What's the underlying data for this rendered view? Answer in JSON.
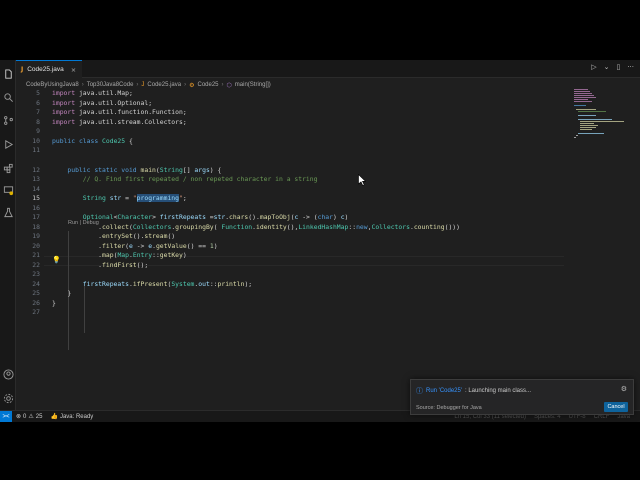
{
  "tab": {
    "icon": "J",
    "title": "Code25.java",
    "close": "×"
  },
  "breadcrumb": [
    "CodeByUsingJava8",
    "Top30Java8Code",
    "Code25.java",
    "Code25",
    "main(String[])"
  ],
  "editor": {
    "codelens_run": "Run",
    "codelens_sep": "|",
    "codelens_debug": "Debug",
    "lines": [
      {
        "n": "5",
        "tokens": [
          [
            "kw2",
            "import "
          ],
          [
            "op",
            "java.util.Map;"
          ]
        ]
      },
      {
        "n": "6",
        "tokens": [
          [
            "kw2",
            "import "
          ],
          [
            "op",
            "java.util.Optional;"
          ]
        ]
      },
      {
        "n": "7",
        "tokens": [
          [
            "kw2",
            "import "
          ],
          [
            "op",
            "java.util.function.Function;"
          ]
        ]
      },
      {
        "n": "8",
        "tokens": [
          [
            "kw2",
            "import "
          ],
          [
            "op",
            "java.util.stream.Collectors;"
          ]
        ]
      },
      {
        "n": "9",
        "tokens": []
      },
      {
        "n": "10",
        "tokens": [
          [
            "kw",
            "public "
          ],
          [
            "kw",
            "class "
          ],
          [
            "ty",
            "Code25"
          ],
          [
            "op",
            " {"
          ]
        ]
      },
      {
        "n": "11",
        "tokens": []
      },
      {
        "n": "12",
        "tokens": [
          [
            "op",
            "    "
          ],
          [
            "kw",
            "public "
          ],
          [
            "kw",
            "static "
          ],
          [
            "kw",
            "void "
          ],
          [
            "fn",
            "main"
          ],
          [
            "op",
            "("
          ],
          [
            "ty",
            "String"
          ],
          [
            "op",
            "[] "
          ],
          [
            "vr",
            "args"
          ],
          [
            "op",
            ") {"
          ]
        ]
      },
      {
        "n": "13",
        "tokens": [
          [
            "cm",
            "        // Q. Find first repeated / non repeted character in a string"
          ]
        ]
      },
      {
        "n": "14",
        "tokens": []
      },
      {
        "n": "15",
        "tokens": [
          [
            "op",
            "        "
          ],
          [
            "ty",
            "String "
          ],
          [
            "vr",
            "str"
          ],
          [
            "op",
            " = "
          ],
          [
            "st",
            "\""
          ],
          [
            "sel",
            "programming"
          ],
          [
            "st",
            "\""
          ],
          [
            "op",
            ";"
          ]
        ]
      },
      {
        "n": "16",
        "tokens": []
      },
      {
        "n": "17",
        "tokens": [
          [
            "op",
            "        "
          ],
          [
            "ty",
            "Optional"
          ],
          [
            "op",
            "<"
          ],
          [
            "ty",
            "Character"
          ],
          [
            "op",
            "> "
          ],
          [
            "vr",
            "firstRepeats"
          ],
          [
            "op",
            " ="
          ],
          [
            "vr",
            "str"
          ],
          [
            "op",
            "."
          ],
          [
            "fn",
            "chars"
          ],
          [
            "op",
            "()."
          ],
          [
            "fn",
            "mapToObj"
          ],
          [
            "op",
            "("
          ],
          [
            "vr",
            "c"
          ],
          [
            "op",
            " -> ("
          ],
          [
            "kw",
            "char"
          ],
          [
            "op",
            ") "
          ],
          [
            "vr",
            "c"
          ],
          [
            "op",
            ")"
          ]
        ]
      },
      {
        "n": "18",
        "tokens": [
          [
            "op",
            "            ."
          ],
          [
            "fn",
            "collect"
          ],
          [
            "op",
            "("
          ],
          [
            "ty",
            "Collectors"
          ],
          [
            "op",
            "."
          ],
          [
            "fn",
            "groupingBy"
          ],
          [
            "op",
            "( "
          ],
          [
            "ty",
            "Function"
          ],
          [
            "op",
            "."
          ],
          [
            "fn",
            "identity"
          ],
          [
            "op",
            "(),"
          ],
          [
            "ty",
            "LinkedHashMap"
          ],
          [
            "op",
            "::"
          ],
          [
            "kw",
            "new"
          ],
          [
            "op",
            ","
          ],
          [
            "ty",
            "Collectors"
          ],
          [
            "op",
            "."
          ],
          [
            "fn",
            "counting"
          ],
          [
            "op",
            "()))"
          ]
        ]
      },
      {
        "n": "19",
        "tokens": [
          [
            "op",
            "            ."
          ],
          [
            "fn",
            "entrySet"
          ],
          [
            "op",
            "()."
          ],
          [
            "fn",
            "stream"
          ],
          [
            "op",
            "()"
          ]
        ]
      },
      {
        "n": "20",
        "tokens": [
          [
            "op",
            "            ."
          ],
          [
            "fn",
            "filter"
          ],
          [
            "op",
            "("
          ],
          [
            "vr",
            "e"
          ],
          [
            "op",
            " -> "
          ],
          [
            "vr",
            "e"
          ],
          [
            "op",
            "."
          ],
          [
            "fn",
            "getValue"
          ],
          [
            "op",
            "() == "
          ],
          [
            "nm",
            "1"
          ],
          [
            "op",
            ")"
          ]
        ]
      },
      {
        "n": "21",
        "tokens": [
          [
            "op",
            "            ."
          ],
          [
            "fn",
            "map"
          ],
          [
            "op",
            "("
          ],
          [
            "ty",
            "Map"
          ],
          [
            "op",
            "."
          ],
          [
            "ty",
            "Entry"
          ],
          [
            "op",
            "::"
          ],
          [
            "fn",
            "getKey"
          ],
          [
            "op",
            ")"
          ]
        ]
      },
      {
        "n": "22",
        "tokens": [
          [
            "op",
            "            ."
          ],
          [
            "fn",
            "findFirst"
          ],
          [
            "op",
            "();"
          ]
        ]
      },
      {
        "n": "23",
        "tokens": []
      },
      {
        "n": "24",
        "tokens": [
          [
            "op",
            "        "
          ],
          [
            "vr",
            "firstRepeats"
          ],
          [
            "op",
            "."
          ],
          [
            "fn",
            "ifPresent"
          ],
          [
            "op",
            "("
          ],
          [
            "ty",
            "System"
          ],
          [
            "op",
            "."
          ],
          [
            "vr",
            "out"
          ],
          [
            "op",
            "::"
          ],
          [
            "fn",
            "println"
          ],
          [
            "op",
            ");"
          ]
        ]
      },
      {
        "n": "25",
        "tokens": [
          [
            "op",
            "    }"
          ]
        ]
      },
      {
        "n": "26",
        "tokens": [
          [
            "op",
            "}"
          ]
        ]
      },
      {
        "n": "27",
        "tokens": []
      }
    ]
  },
  "statusbar": {
    "remote": "><",
    "errors": "0",
    "warnings": "25",
    "java": "Java: Ready",
    "position": "Ln 15, Col 33 (11 selected)",
    "spaces": "Spaces: 4",
    "encoding": "UTF-8",
    "eol": "CRLF",
    "lang": "Java"
  },
  "notification": {
    "run_label": "Run 'Code25'",
    "message": ": Launching main class...",
    "source": "Source: Debugger for Java",
    "cancel": "Cancel"
  },
  "colors": {
    "accent": "#0078d4",
    "bg": "#1f1f1f",
    "sidebar": "#181818"
  }
}
